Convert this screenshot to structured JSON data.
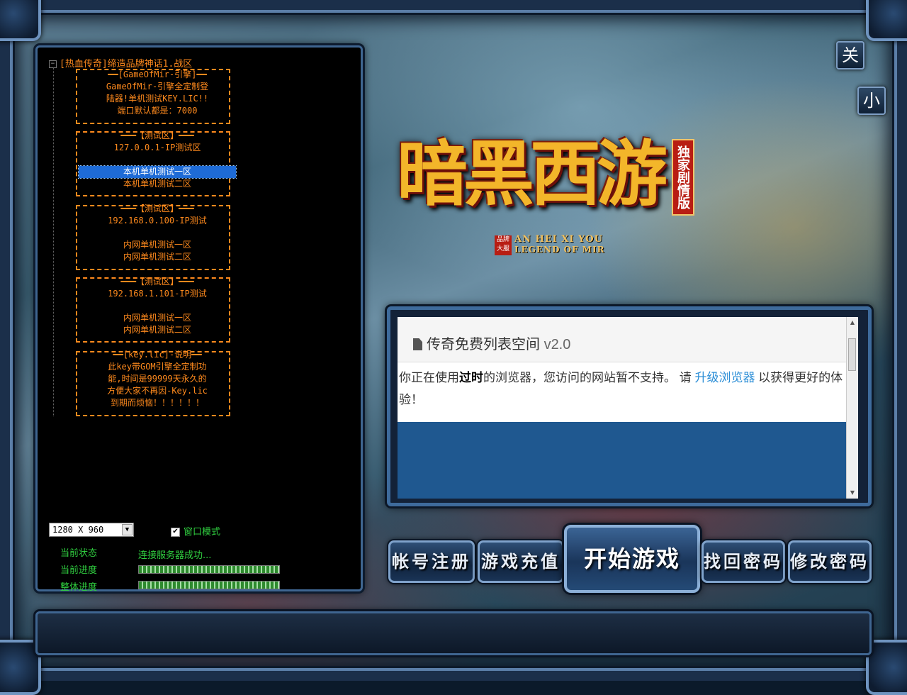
{
  "window": {
    "close_label": "关",
    "minimize_label": "小"
  },
  "server_tree": {
    "root": "[热血传奇]缔造品牌神话1.战区",
    "items": [
      "━━[GameOfMir-引擎]━━",
      "GameOfMir-引擎全定制登",
      "陆器!单机测试KEY.LIC!!",
      "端口默认都是：7000",
      "━━━【测试区】━━━",
      "127.0.0.1-IP测试区",
      "本机单机测试一区",
      "本机单机测试二区",
      "━━━【测试区】━━━",
      "192.168.0.100-IP测试",
      "内网单机测试一区",
      "内网单机测试二区",
      "━━━【测试区】━━━",
      "192.168.1.101-IP测试",
      "内网单机测试一区",
      "内网单机测试二区",
      "━━[key.lic]-说明━━",
      "此key带GOM引擎全定制功",
      "能,时间是99999天永久的",
      "方便大家不再因-Key.lic",
      "到期而烦恼！！！！！！"
    ]
  },
  "settings": {
    "resolution": "1280 X 960",
    "window_mode_label": "窗口模式",
    "window_mode_checked": true,
    "status_label": "当前状态",
    "status_value": "连接服务器成功...",
    "progress_label": "当前进度",
    "progress_value": 1.0,
    "overall_label": "整体进度",
    "overall_value": 1.0
  },
  "logo": {
    "title": "暗黑西游",
    "badge": "独家剧情版",
    "tag": "品牌大服",
    "en_line1": "AN HEI XI YOU",
    "en_line2": "LEGEND OF MIR"
  },
  "browser": {
    "title": "传奇免费列表空间",
    "version": "v2.0",
    "msg_part1": "你正在使用",
    "msg_bold": "过时",
    "msg_part2": "的浏览器，您访问的网站暂不支持。 请 ",
    "msg_link": "升级浏览器",
    "msg_part3": " 以获得更好的体验！"
  },
  "actions": {
    "register": "帐号注册",
    "recharge": "游戏充值",
    "start": "开始游戏",
    "recover": "找回密码",
    "change_pw": "修改密码"
  },
  "icons": {
    "expander": "minus-box-icon",
    "dropdown": "chevron-down-icon",
    "document": "document-icon"
  }
}
